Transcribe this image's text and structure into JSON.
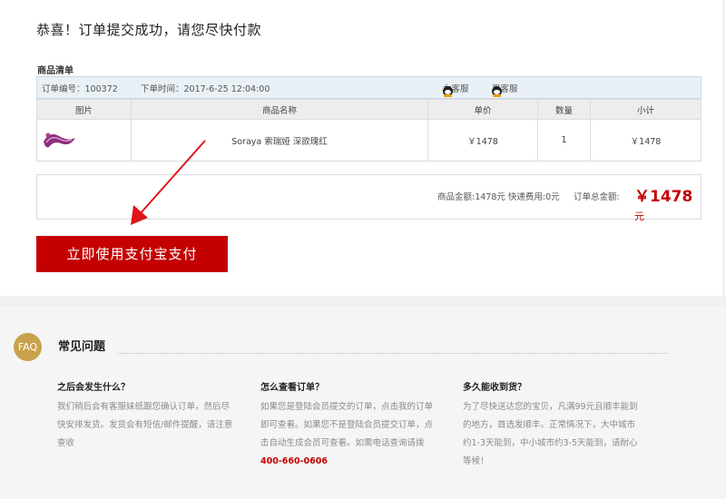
{
  "page": {
    "title": "恭喜！订单提交成功，请您尽快付款"
  },
  "order": {
    "list_label": "商品清单",
    "order_no_label": "订单编号：",
    "order_no": "100372",
    "time_label": "下单时间：",
    "time": "2017-6-25 12:04:00",
    "service_female": "女客服",
    "service_male": "男客服"
  },
  "table": {
    "headers": [
      "图片",
      "商品名称",
      "单价",
      "数量",
      "小计"
    ],
    "rows": [
      {
        "name": "Soraya 索瑞娅 深欲瑰红",
        "price": "￥1478",
        "qty": "1",
        "subtotal": "￥1478"
      }
    ]
  },
  "summary": {
    "goods_amount": "商品金额:1478元  快递费用:0元",
    "total_label": "订单总金额:",
    "total_value": "￥1478",
    "total_unit": "元"
  },
  "pay_button": "立即使用支付宝支付",
  "faq": {
    "badge": "FAQ",
    "title": "常见问题",
    "items": [
      {
        "q": "之后会发生什么？",
        "a": [
          "我们稍后会有客服妹纸跟您确认订单，然后尽",
          "快安排发货。发货会有短信/邮件提醒，请注意",
          "查收"
        ]
      },
      {
        "q": "怎么查看订单？",
        "a": [
          "如果您是登陆会员提交的订单，点击我的订单",
          "即可查看。如果您不是登陆会员提交订单，点",
          "击自动生成会员可查看。如需电话查询请拨"
        ],
        "phone": "400-660-0606"
      },
      {
        "q": "多久能收到货？",
        "a": [
          "为了尽快送达您的宝贝，凡满99元且顺丰能到",
          "的地方，首选发顺丰。正常情况下，大中城市",
          "约1-3天能到，中小城市约3-5天能到，请耐心",
          "等候！"
        ]
      }
    ]
  },
  "colors": {
    "accent": "#c40000",
    "faq_badge": "#c9a24c",
    "bar": "#e9f0f6"
  }
}
